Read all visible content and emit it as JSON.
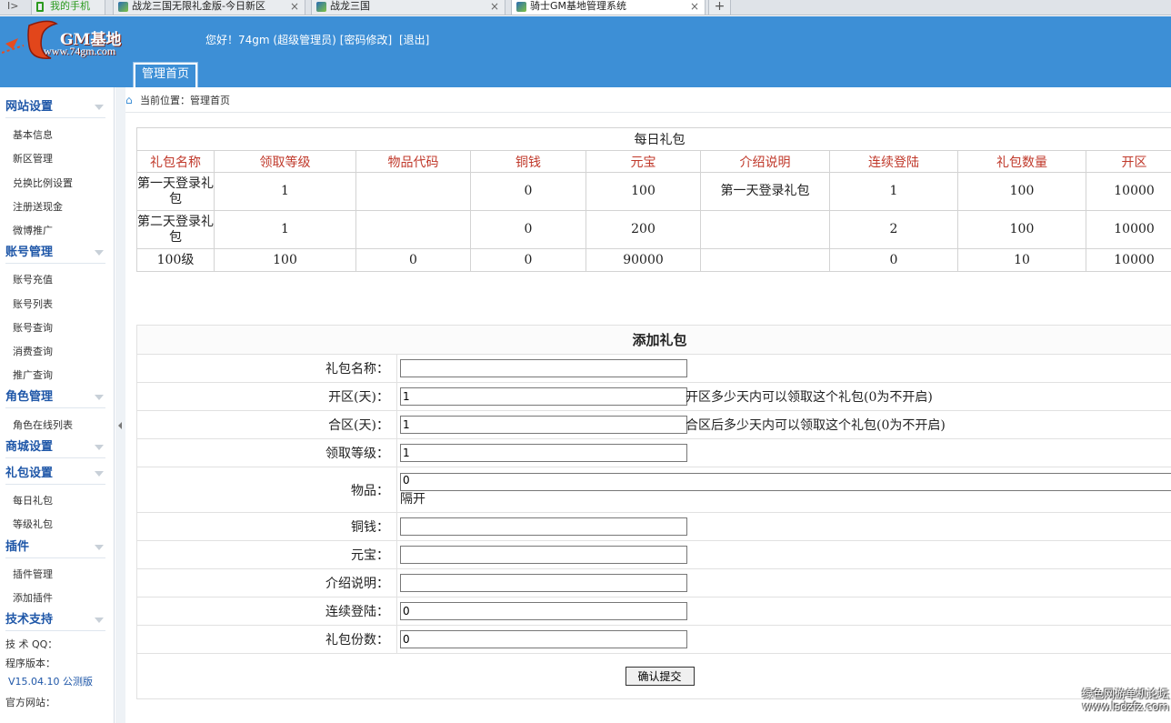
{
  "browser": {
    "back": "I>",
    "tabs": [
      {
        "label": "我的手机"
      },
      {
        "label": "战龙三国无限礼金版-今日新区"
      },
      {
        "label": "战龙三国"
      },
      {
        "label": "骑士GM基地管理系统"
      }
    ],
    "close_glyph": "×",
    "new_tab": "+"
  },
  "header": {
    "logo_text": "GM基地",
    "logo_url": "www.74gm.com",
    "welcome": "您好！74gm (超级管理员)",
    "change_password": "[密码修改]",
    "logout": "[退出]",
    "main_tab": "管理首页"
  },
  "sidebar": {
    "sections": [
      {
        "title": "网站设置",
        "items": [
          "基本信息",
          "新区管理",
          "兑换比例设置",
          "注册送现金",
          "微博推广"
        ]
      },
      {
        "title": "账号管理",
        "items": [
          "账号充值",
          "账号列表",
          "账号查询",
          "消费查询",
          "推广查询"
        ]
      },
      {
        "title": "角色管理",
        "items": [
          "角色在线列表"
        ]
      },
      {
        "title": "商城设置",
        "items": []
      },
      {
        "title": "礼包设置",
        "items": [
          "每日礼包",
          "等级礼包"
        ]
      },
      {
        "title": "插件",
        "items": [
          "插件管理",
          "添加插件"
        ]
      },
      {
        "title": "技术支持",
        "items": []
      }
    ],
    "support": {
      "qq": "技 术 QQ：",
      "version_label": "程序版本：",
      "version": "V15.04.10 公测版",
      "site": "官方网站："
    }
  },
  "breadcrumb": {
    "home_icon": "⌂",
    "text": "当前位置：管理首页"
  },
  "gift_table": {
    "caption": "每日礼包",
    "columns": [
      "礼包名称",
      "领取等级",
      "物品代码",
      "铜钱",
      "元宝",
      "介绍说明",
      "连续登陆",
      "礼包数量",
      "开区"
    ],
    "rows": [
      [
        "第一天登录礼包",
        "1",
        "",
        "0",
        "100",
        "第一天登录礼包",
        "1",
        "100",
        "10000"
      ],
      [
        "第二天登录礼包",
        "1",
        "",
        "0",
        "200",
        "",
        "2",
        "100",
        "10000"
      ],
      [
        "100级",
        "100",
        "0",
        "0",
        "90000",
        "",
        "0",
        "10",
        "10000"
      ]
    ]
  },
  "add_form": {
    "title": "添加礼包",
    "fields": {
      "name": {
        "label": "礼包名称：",
        "value": ""
      },
      "open_days": {
        "label": "开区(天)：",
        "value": "1",
        "hint": "开区多少天内可以领取这个礼包(0为不开启)"
      },
      "merge_days": {
        "label": "合区(天)：",
        "value": "1",
        "hint": "合区后多少天内可以领取这个礼包(0为不开启)"
      },
      "level": {
        "label": "领取等级：",
        "value": "1"
      },
      "items": {
        "label": "物品：",
        "value": "0",
        "separator_note": "隔开"
      },
      "copper": {
        "label": "铜钱：",
        "value": ""
      },
      "ingot": {
        "label": "元宝：",
        "value": ""
      },
      "description": {
        "label": "介绍说明：",
        "value": ""
      },
      "consecutive": {
        "label": "连续登陆：",
        "value": "0"
      },
      "count": {
        "label": "礼包份数：",
        "value": "0"
      }
    },
    "submit": "确认提交"
  },
  "watermark": {
    "line1": "绿色网游单机论坛",
    "line2": "www.lsdzfz.com"
  }
}
